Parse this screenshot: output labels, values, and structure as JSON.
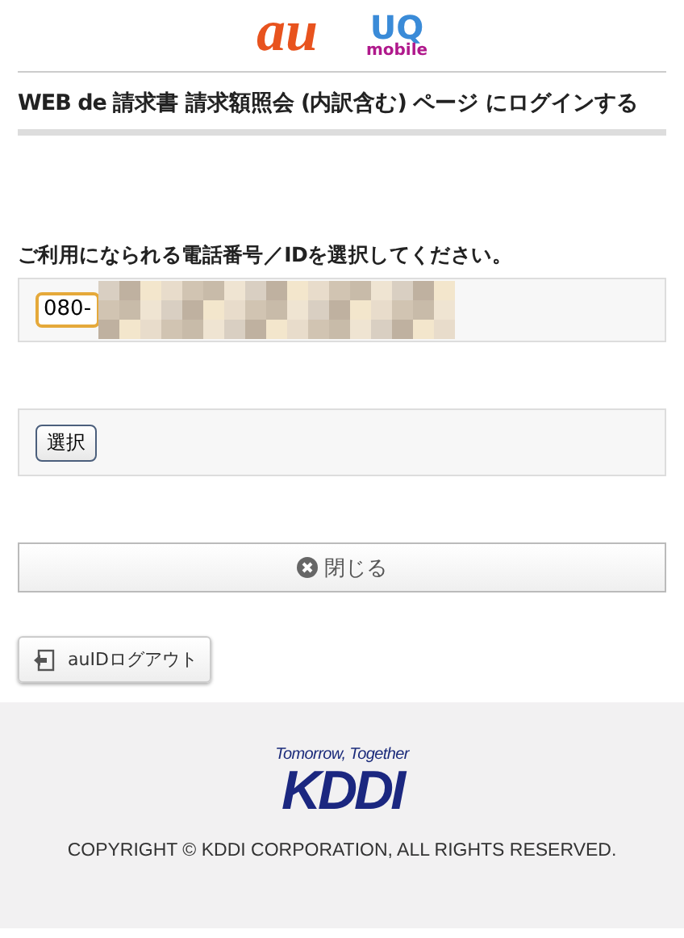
{
  "logos": {
    "au": "au",
    "uq": "UQ",
    "uq_sub": "mobile"
  },
  "heading": "WEB de 請求書 請求額照会 (内訳含む) ページ  にログインする",
  "prompt": "ご利用になられる電話番号／IDを選択してください。",
  "number_select": {
    "value": "080-",
    "redacted": true
  },
  "select_button": "選択",
  "close_button": "閉じる",
  "logout_button": "auIDログアウト",
  "footer": {
    "tagline": "Tomorrow, Together",
    "logo": "KDDI",
    "copyright": "COPYRIGHT © KDDI CORPORATION, ALL RIGHTS RESERVED."
  }
}
